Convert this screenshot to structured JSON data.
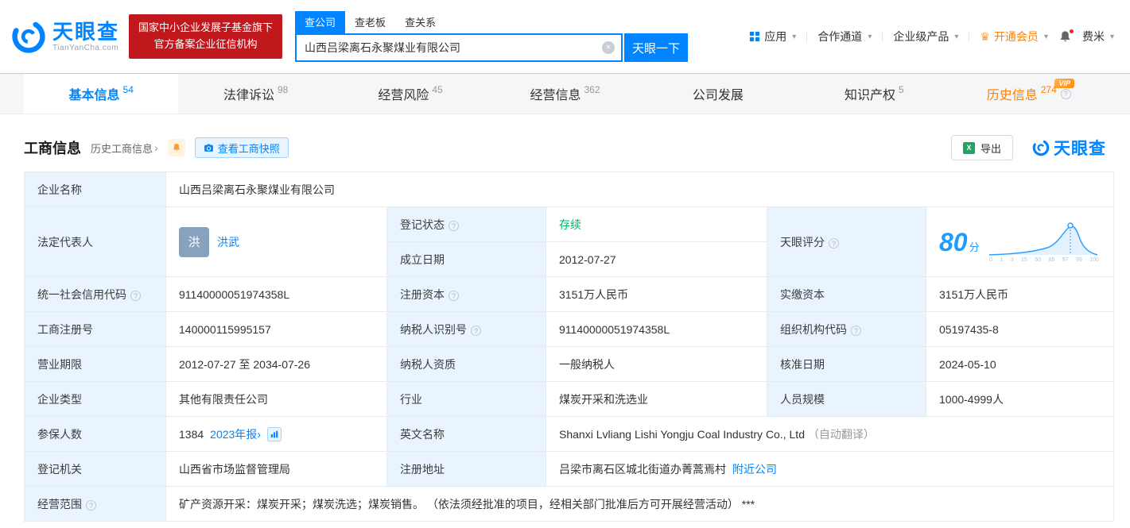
{
  "colors": {
    "brand_blue": "#0084ff",
    "vip_orange": "#ff8000",
    "status_green": "#00b365",
    "badge_red": "#c0181d",
    "score_blue": "#1f9bff"
  },
  "header": {
    "logo": {
      "brand": "天眼查",
      "domain": "TianYanCha.com"
    },
    "badge": {
      "line1": "国家中小企业发展子基金旗下",
      "line2": "官方备案企业征信机构"
    },
    "search": {
      "tabs": [
        {
          "label": "查公司"
        },
        {
          "label": "查老板"
        },
        {
          "label": "查关系"
        }
      ],
      "value": "山西吕梁离石永聚煤业有限公司",
      "button": "天眼一下"
    },
    "nav": {
      "apps": "应用",
      "partner": "合作通道",
      "enterprise": "企业级产品",
      "vip": "开通会员",
      "user": "费米"
    }
  },
  "tabs": [
    {
      "label": "基本信息",
      "count": "54"
    },
    {
      "label": "法律诉讼",
      "count": "98"
    },
    {
      "label": "经营风险",
      "count": "45"
    },
    {
      "label": "经营信息",
      "count": "362"
    },
    {
      "label": "公司发展",
      "count": ""
    },
    {
      "label": "知识产权",
      "count": "5"
    },
    {
      "label": "历史信息",
      "count": "274",
      "vip_badge": "VIP"
    }
  ],
  "section": {
    "title": "工商信息",
    "history_link": "历史工商信息",
    "snapshot_button": "查看工商快照",
    "export_button": "导出",
    "watermark": "天眼查"
  },
  "company": {
    "name_label": "企业名称",
    "name": "山西吕梁离石永聚煤业有限公司",
    "legal_rep_label": "法定代表人",
    "legal_rep_avatar": "洪",
    "legal_rep": "洪武",
    "reg_status_label": "登记状态",
    "reg_status": "存续",
    "score_label": "天眼评分",
    "score": "80",
    "score_unit": "分",
    "establish_label": "成立日期",
    "establish_date": "2012-07-27",
    "credit_code_label": "统一社会信用代码",
    "credit_code": "91140000051974358L",
    "reg_capital_label": "注册资本",
    "reg_capital": "3151万人民币",
    "paid_capital_label": "实缴资本",
    "paid_capital": "3151万人民币",
    "reg_number_label": "工商注册号",
    "reg_number": "140000115995157",
    "taxpayer_id_label": "纳税人识别号",
    "taxpayer_id": "91140000051974358L",
    "org_code_label": "组织机构代码",
    "org_code": "05197435-8",
    "term_label": "营业期限",
    "term": "2012-07-27 至 2034-07-26",
    "taxpayer_quality_label": "纳税人资质",
    "taxpayer_quality": "一般纳税人",
    "approval_date_label": "核准日期",
    "approval_date": "2024-05-10",
    "company_type_label": "企业类型",
    "company_type": "其他有限责任公司",
    "industry_label": "行业",
    "industry": "煤炭开采和洗选业",
    "staff_label": "人员规模",
    "staff": "1000-4999人",
    "insured_label": "参保人数",
    "insured": "1384",
    "annual_report_link": "2023年报",
    "english_name_label": "英文名称",
    "english_name": "Shanxi Lvliang Lishi Yongju Coal Industry Co., Ltd",
    "english_name_note": "（自动翻译）",
    "reg_authority_label": "登记机关",
    "reg_authority": "山西省市场监督管理局",
    "address_label": "注册地址",
    "address": "吕梁市离石区城北街道办菁蒿焉村",
    "nearby_link": "附近公司",
    "scope_label": "经营范围",
    "scope": "矿产资源开采：煤炭开采；煤炭洗选；煤炭销售。 （依法须经批准的项目，经相关部门批准后方可开展经营活动） ***"
  },
  "score_chart": {
    "ticks": [
      "0",
      "1",
      "3",
      "15",
      "50",
      "85",
      "97",
      "99",
      "100"
    ]
  },
  "icons": {
    "caret_down": "▾",
    "chevron_right": "›",
    "question": "?",
    "clear": "×",
    "crown": "♛",
    "excel": "X"
  }
}
